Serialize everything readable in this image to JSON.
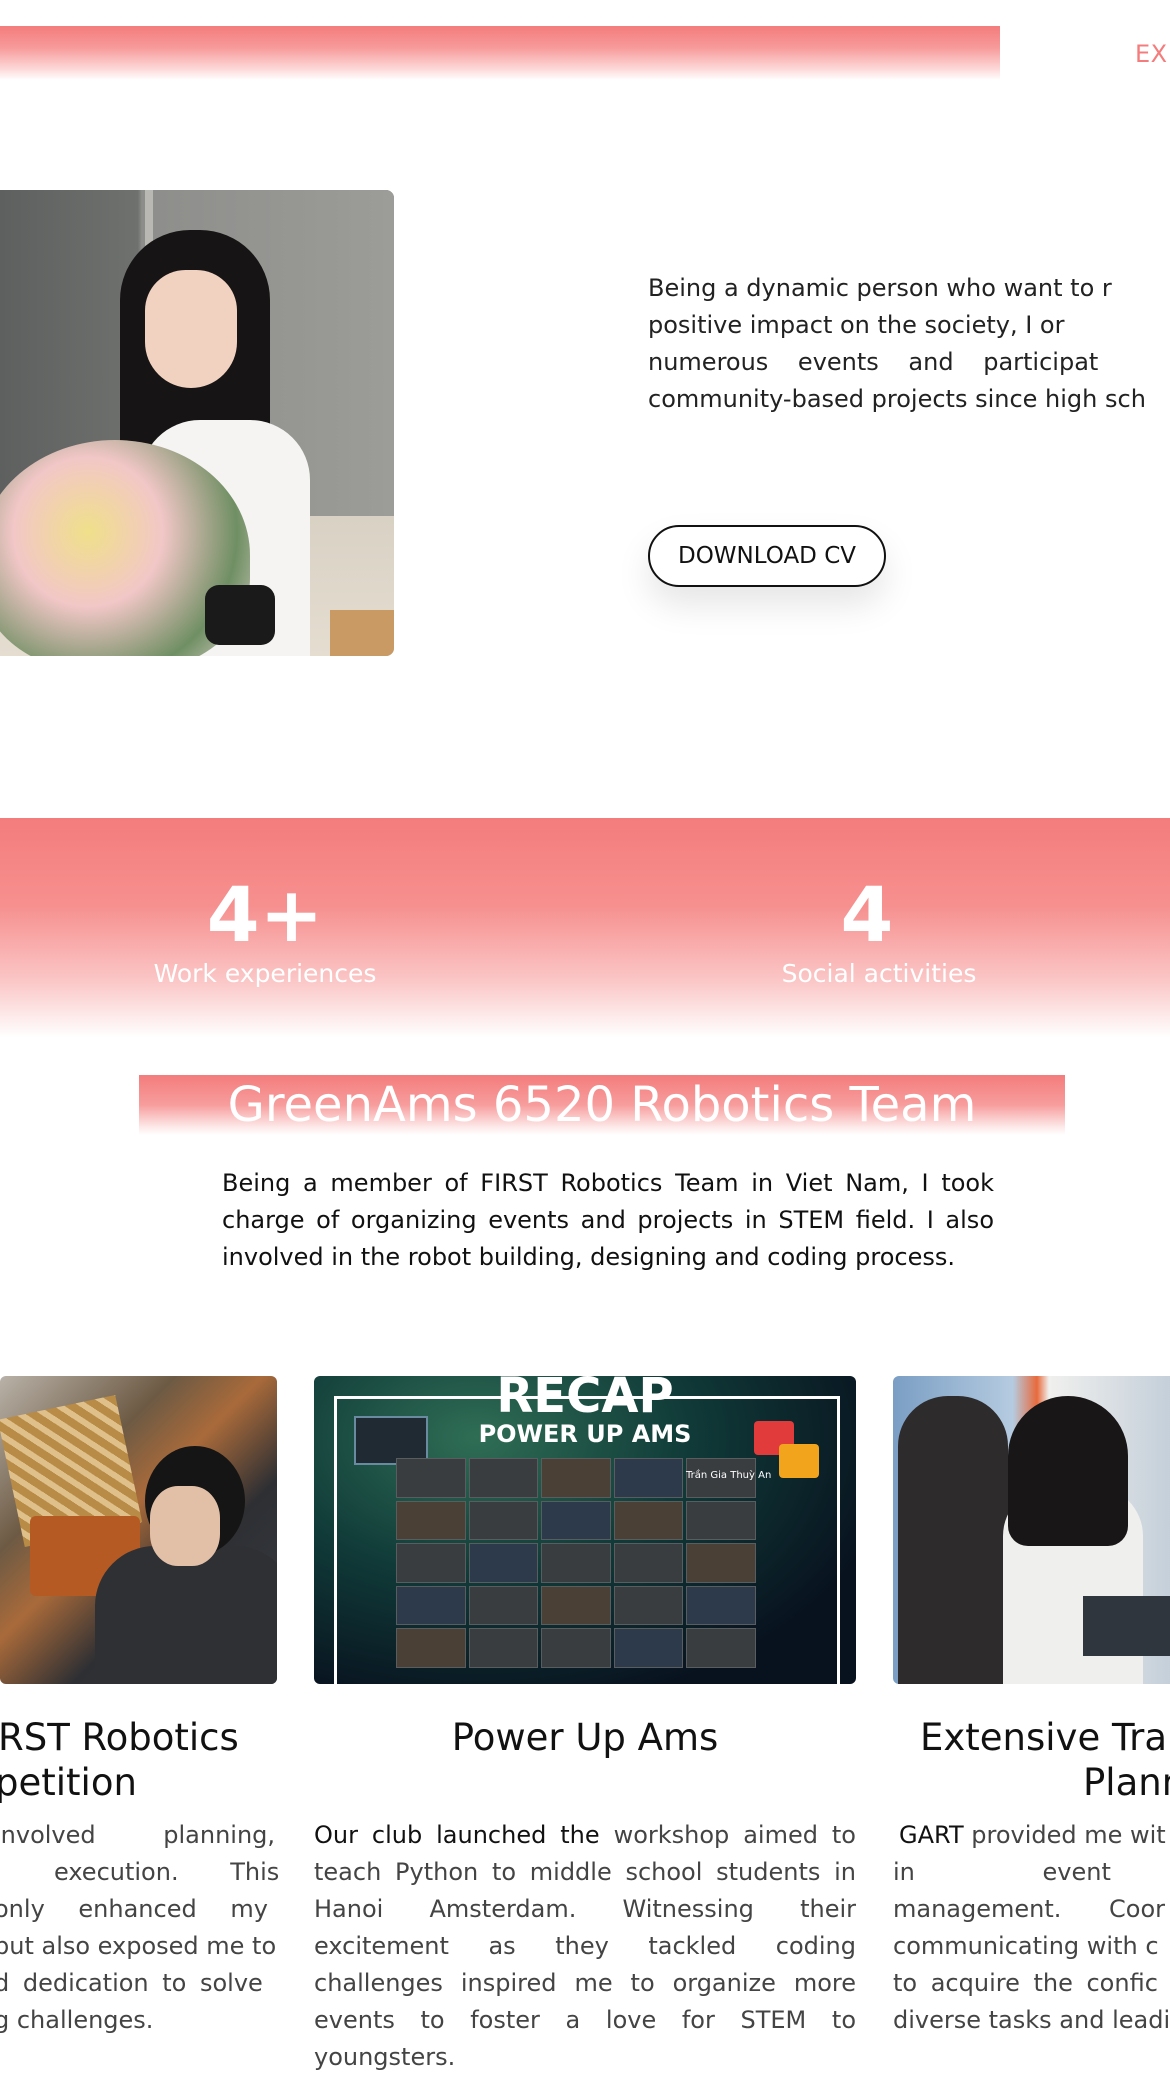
{
  "nav": {
    "partial_item": "EXI"
  },
  "hero": {
    "text_lines": [
      "Being a dynamic person who want to r",
      "positive impact on the society, I or",
      "numerous events and participat",
      "community-based projects since high sch"
    ],
    "cv_button": "DOWNLOAD CV"
  },
  "stats": [
    {
      "value": "4+",
      "label": "Work experiences"
    },
    {
      "value": "4",
      "label": "Social activities"
    }
  ],
  "section": {
    "title": "GreenAms 6520 Robotics Team",
    "description": "Being a member of FIRST Robotics Team in Viet Nam, I took charge of organizing events and projects in STEM field. I also involved in the robot building, designing and coding process."
  },
  "cards": [
    {
      "title_lines": [
        "RST Robotics",
        "petition"
      ],
      "text_lines": [
        "involved planning,",
        "execution. This",
        "only enhanced my",
        "but also exposed me to",
        "d dedication to solve",
        "g challenges."
      ]
    },
    {
      "image_text": {
        "recap": "RECAP",
        "subtitle": "POWER UP AMS",
        "name_tag": "Trần Gia Thuỳ An"
      },
      "title": "Power Up Ams",
      "text_highlight": "Our club launched the",
      "text_rest": " workshop aimed to teach Python to middle school students in Hanoi Amsterdam. Witnessing their excitement as they tackled coding challenges inspired me to organize more events to foster a love for STEM to youngsters."
    },
    {
      "title_lines": [
        "Extensive Trai",
        "Plann"
      ],
      "text_highlight": "GART",
      "text_lines": [
        " provided me wit",
        "in event",
        "management. Coor",
        "communicating with c",
        "to acquire the confic",
        "diverse tasks and leadi"
      ]
    }
  ],
  "colors": {
    "accent": "#f47c7c",
    "text": "#111111"
  }
}
